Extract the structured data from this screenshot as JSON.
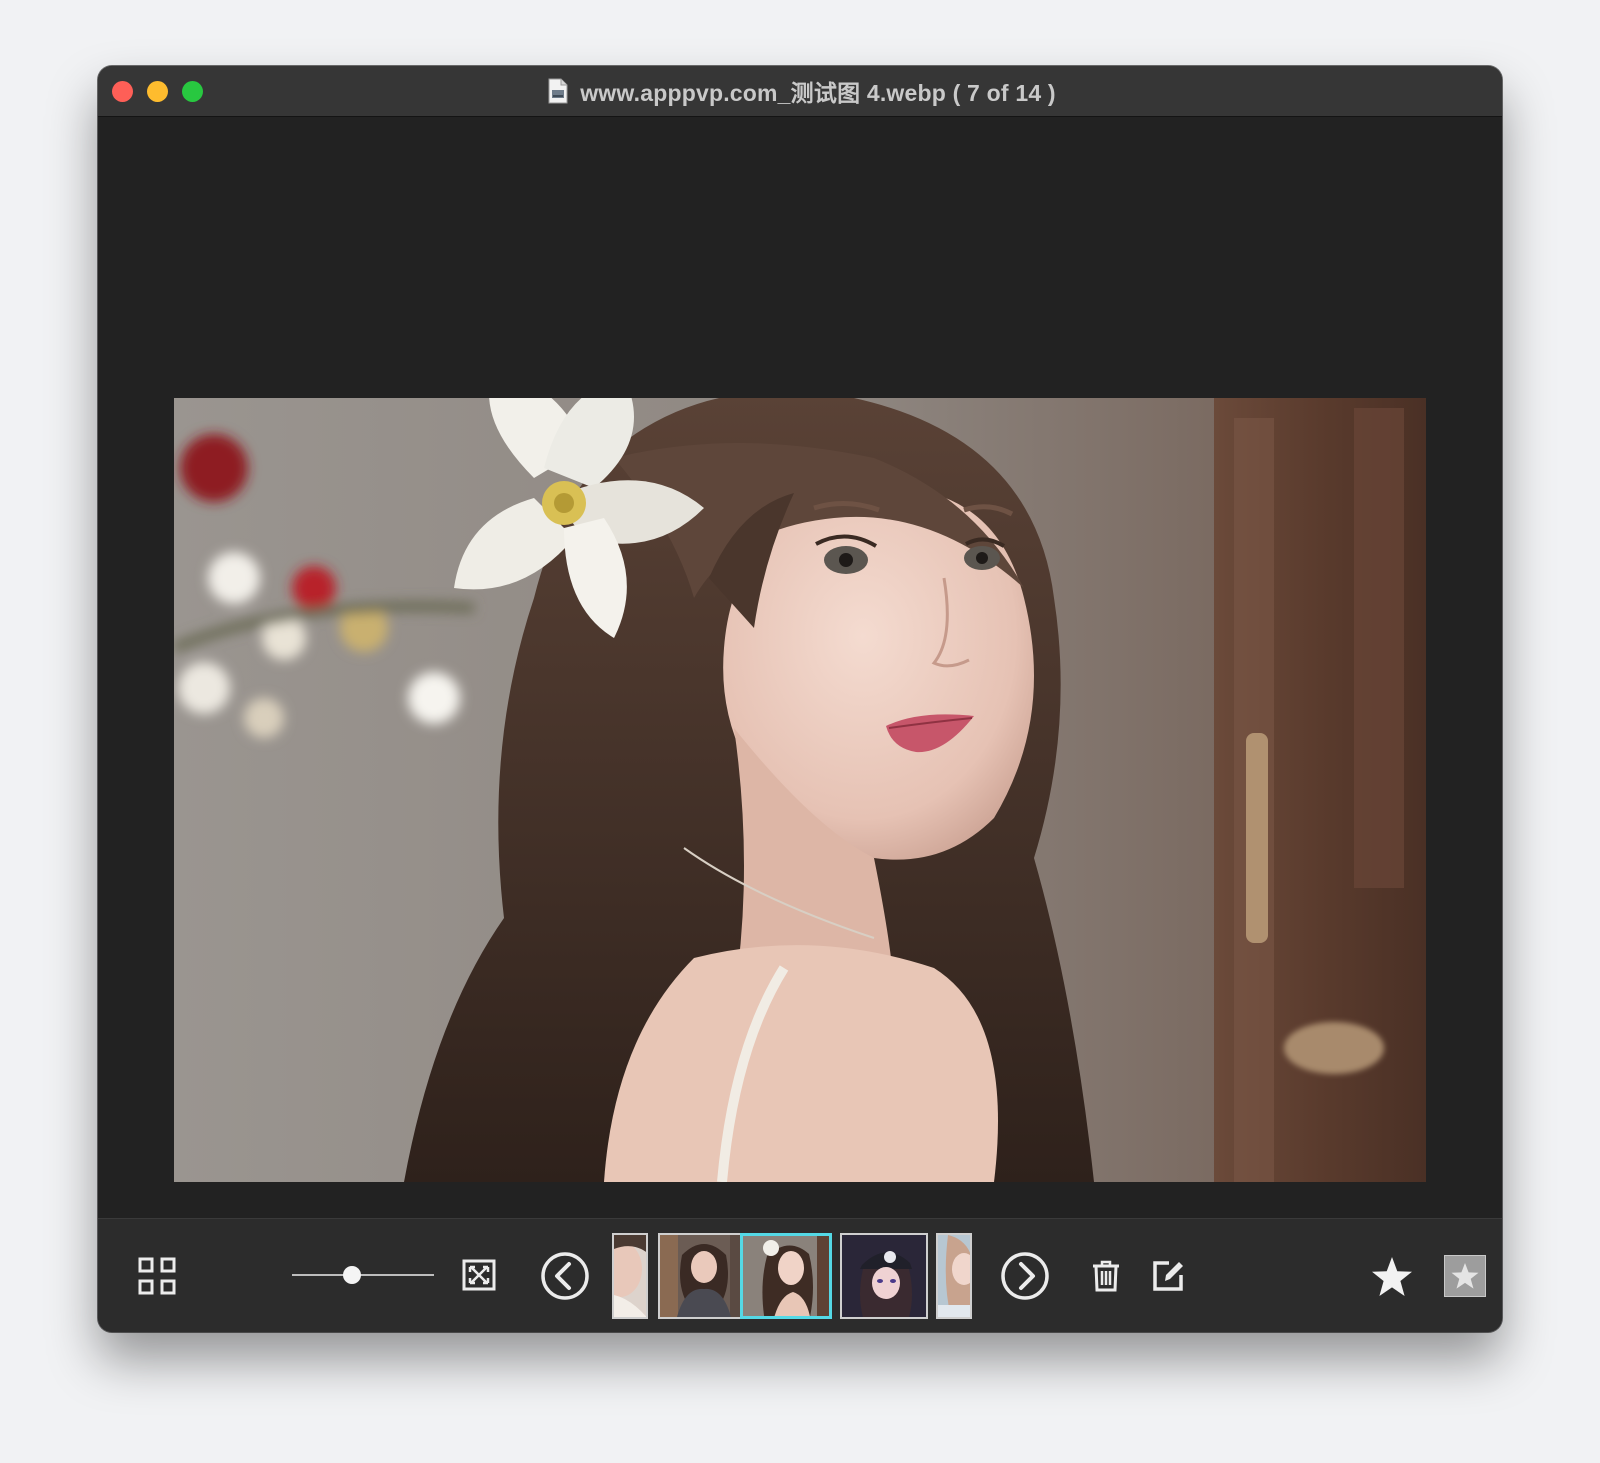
{
  "window": {
    "title": "www.apppvp.com_测试图 4.webp ( 7 of 14 )"
  },
  "image": {
    "subject": "portrait photo"
  },
  "toolbar": {
    "zoom_level": 0.42,
    "thumbnails": [
      {
        "index": 5,
        "current": false
      },
      {
        "index": 6,
        "current": false
      },
      {
        "index": 7,
        "current": true
      },
      {
        "index": 8,
        "current": false
      },
      {
        "index": 9,
        "current": false
      }
    ],
    "icons": {
      "grid": "grid-view-icon",
      "fit": "fit-to-window-icon",
      "prev": "chevron-left-circle-icon",
      "next": "chevron-right-circle-icon",
      "trash": "trash-icon",
      "edit": "edit-icon",
      "favorite": "star-icon",
      "rating": "star-box-icon"
    }
  },
  "colors": {
    "close": "#fe5f57",
    "minimize": "#febc2e",
    "maximize": "#28c840",
    "selection": "#54d9e6",
    "window_bg": "#222222",
    "toolbar_bg": "#2c2c2c"
  }
}
